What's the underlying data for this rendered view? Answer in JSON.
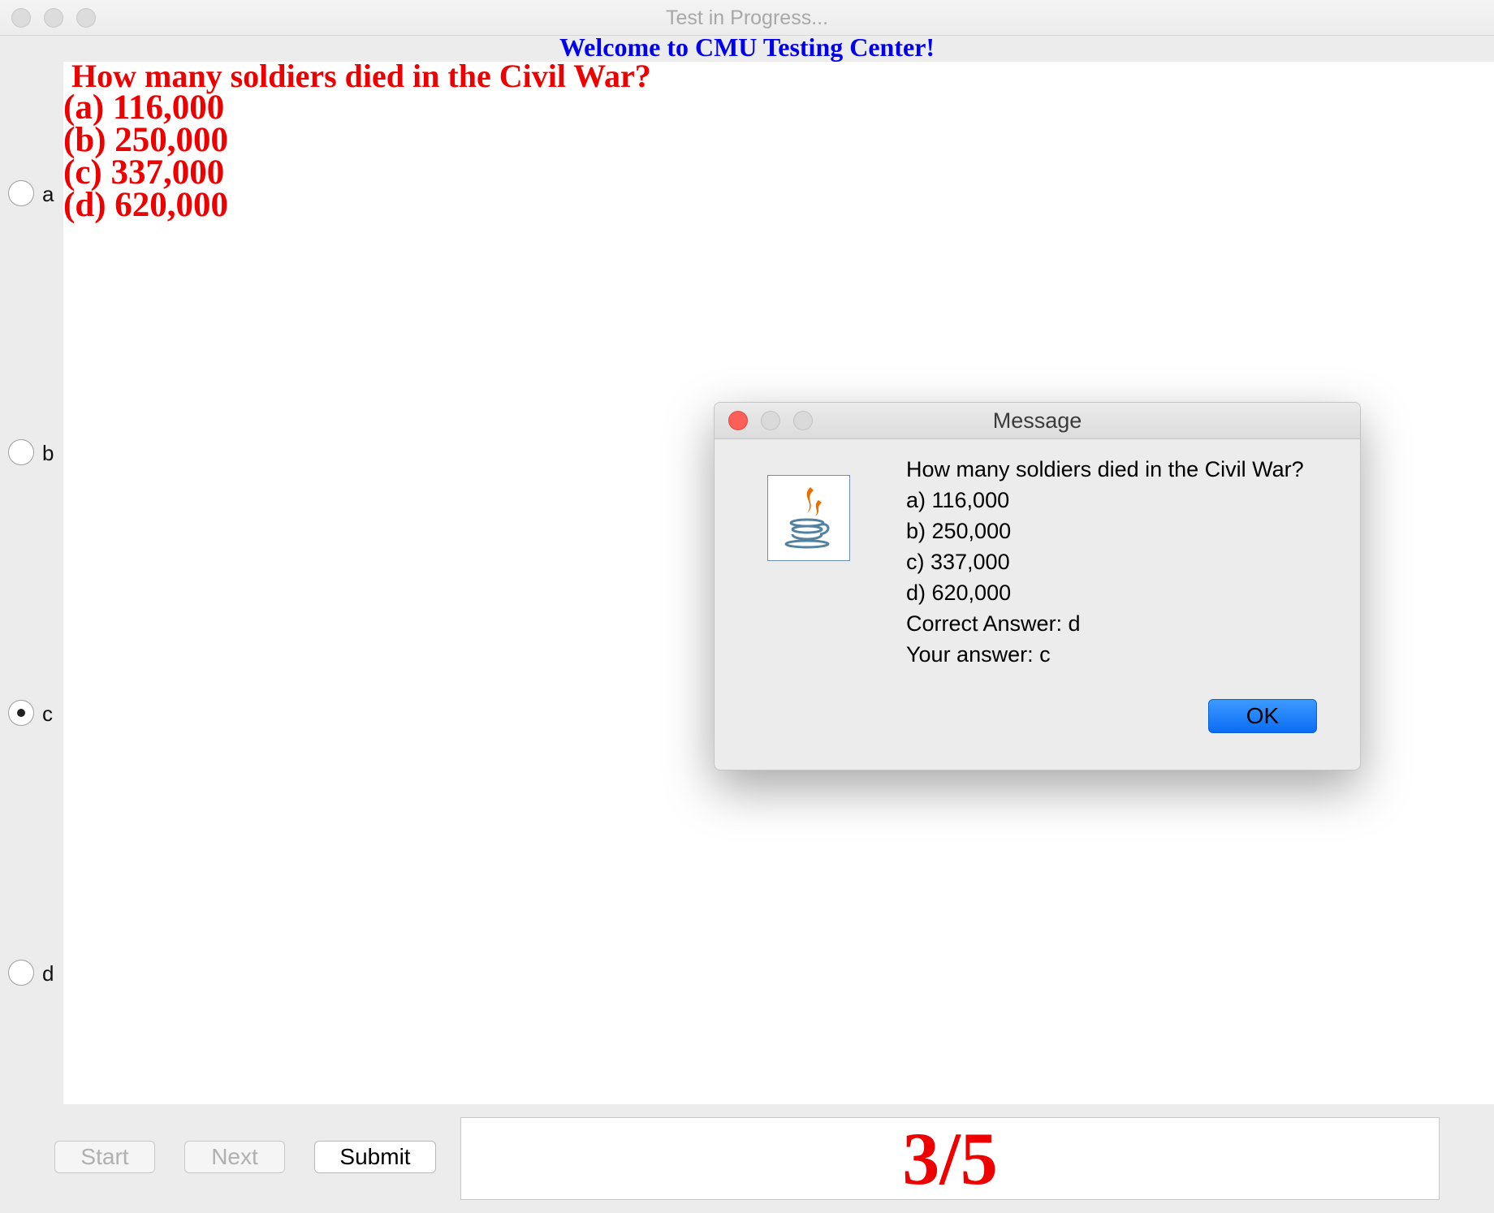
{
  "window": {
    "title": "Test in Progress...",
    "welcome": "Welcome to CMU Testing Center!"
  },
  "question": {
    "title": "How many soldiers died in the Civil War?",
    "options": [
      "(a)  116,000",
      "(b)  250,000",
      "(c)  337,000",
      "(d)  620,000"
    ]
  },
  "choices": [
    {
      "label": "a",
      "selected": false
    },
    {
      "label": "b",
      "selected": false
    },
    {
      "label": "c",
      "selected": true
    },
    {
      "label": "d",
      "selected": false
    }
  ],
  "buttons": {
    "start": "Start",
    "next": "Next",
    "submit": "Submit"
  },
  "score": "3/5",
  "dialog": {
    "title": "Message",
    "icon": "java-icon",
    "lines": [
      " How many soldiers died in the Civil War?",
      "a) 116,000",
      "b) 250,000",
      "c) 337,000",
      "d) 620,000",
      "Correct Answer: d",
      "Your answer: c"
    ],
    "ok": "OK"
  },
  "colors": {
    "question_text": "#ee0000",
    "welcome_text": "#0000ee",
    "ok_button": "#0a6cf5"
  }
}
